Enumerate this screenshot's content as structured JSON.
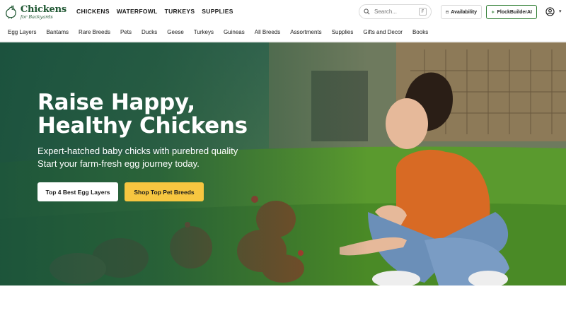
{
  "brand": {
    "name": "Chickens",
    "tagline": "for Backyards",
    "color": "#1e5631"
  },
  "main_nav": [
    "CHICKENS",
    "WATERFOWL",
    "TURKEYS",
    "SUPPLIES"
  ],
  "search": {
    "placeholder": "Search...",
    "shortcut": "F",
    "icon": "search-icon"
  },
  "header_buttons": {
    "availability": "Availability",
    "flockbuilder": "FlockBuilderAI"
  },
  "category_nav": [
    "Egg Layers",
    "Bantams",
    "Rare Breeds",
    "Pets",
    "Ducks",
    "Geese",
    "Turkeys",
    "Guineas",
    "All Breeds",
    "Assortments",
    "Supplies",
    "Gifts and Decor",
    "Books"
  ],
  "hero": {
    "title_line1": "Raise Happy,",
    "title_line2": "Healthy Chickens",
    "subtitle_line1": "Expert-hatched baby chicks with purebred quality",
    "subtitle_line2": "Start your farm-fresh egg journey today.",
    "cta_primary": "Top 4 Best Egg Layers",
    "cta_secondary": "Shop Top Pet Breeds"
  },
  "colors": {
    "accent_yellow": "#f7c640",
    "brand_green": "#1e5631",
    "flock_border": "#2e7d32"
  }
}
